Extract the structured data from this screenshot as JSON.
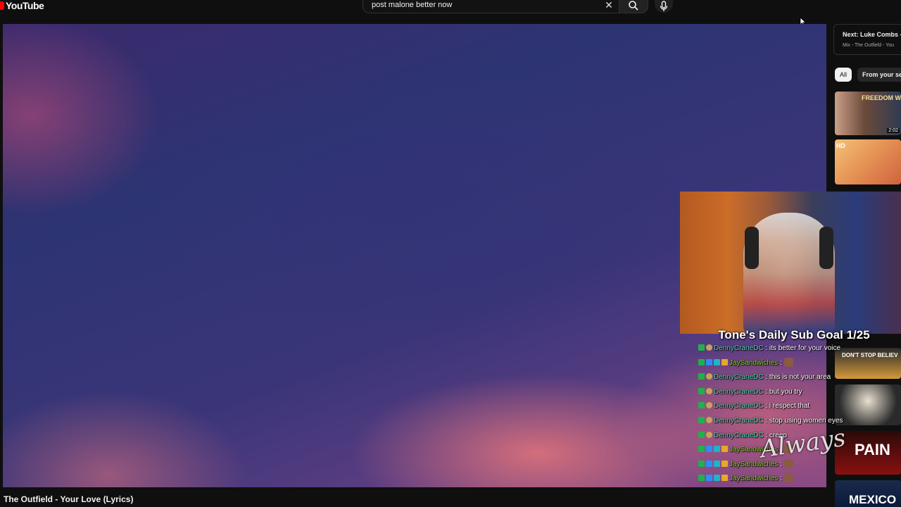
{
  "header": {
    "logo_text": "YouTube",
    "search_value": "post malone better now",
    "icons": [
      "close-icon",
      "search-icon",
      "microphone-icon"
    ]
  },
  "video": {
    "title": "The Outfield - Your Love (Lyrics)"
  },
  "sidebar": {
    "up_next_title": "Next: Luke Combs -",
    "up_next_sub": "Mix - The Outfield - You",
    "chips": [
      "All",
      "From your se"
    ],
    "thumbnails": [
      {
        "label": "FREEDOM WRITE",
        "duration": "2:02"
      },
      {
        "label": "HD",
        "duration": ""
      },
      {
        "label": "DON'T STOP BELIEV",
        "duration": ""
      },
      {
        "label": "",
        "duration": ""
      },
      {
        "label": "PAIN",
        "duration": ""
      },
      {
        "label": "MEXICO",
        "duration": ""
      }
    ]
  },
  "overlay": {
    "sub_goal": "Tone's Daily Sub Goal 1/25",
    "watermark": "Always"
  },
  "chat": [
    {
      "user": "DennyCraneDC",
      "message": ": its better for your voice",
      "kind": "denny"
    },
    {
      "user": "JaySandwiches",
      "message": ":",
      "kind": "jay",
      "emote": true
    },
    {
      "user": "DennyCraneDC",
      "message": ": this is not your area",
      "kind": "denny"
    },
    {
      "user": "DennyCraneDC",
      "message": ": but you try",
      "kind": "denny"
    },
    {
      "user": "DennyCraneDC",
      "message": ": i respect that",
      "kind": "denny"
    },
    {
      "user": "DennyCraneDC",
      "message": ": stop using women eyes",
      "kind": "denny"
    },
    {
      "user": "DennyCraneDC",
      "message": ": creep",
      "kind": "denny"
    },
    {
      "user": "JaySandwiches",
      "message": ":",
      "kind": "jay",
      "emote": true
    },
    {
      "user": "JaySandwiches",
      "message": ":",
      "kind": "jay",
      "emote": true
    },
    {
      "user": "JaySandwiches",
      "message": ":",
      "kind": "jay",
      "emote": true
    }
  ]
}
